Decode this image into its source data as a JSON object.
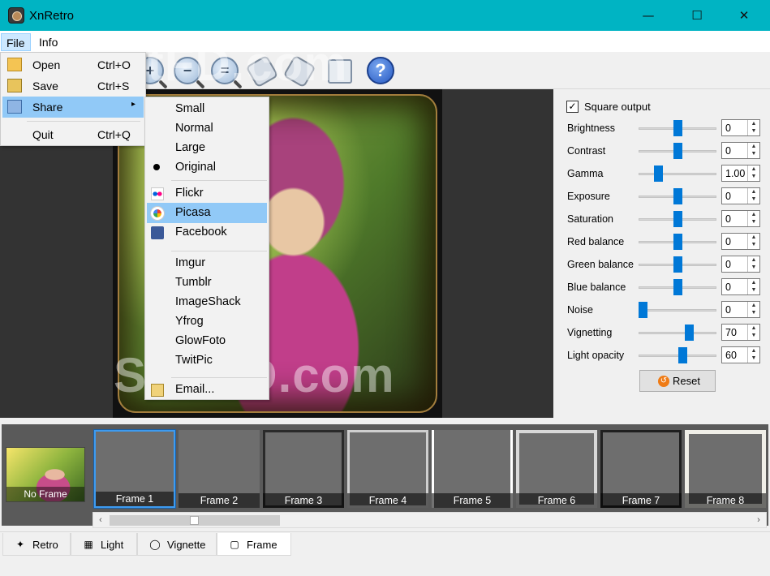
{
  "window": {
    "title": "XnRetro",
    "minimize": "—",
    "maximize": "☐",
    "close": "✕"
  },
  "menubar": {
    "file": "File",
    "info": "Info"
  },
  "file_menu": {
    "open": {
      "label": "Open",
      "shortcut": "Ctrl+O"
    },
    "save": {
      "label": "Save",
      "shortcut": "Ctrl+S"
    },
    "share": {
      "label": "Share",
      "arrow": "▸"
    },
    "quit": {
      "label": "Quit",
      "shortcut": "Ctrl+Q"
    }
  },
  "share_menu": {
    "sizes": [
      "Small",
      "Normal",
      "Large",
      "Original"
    ],
    "selected_size": "Original",
    "services_a": [
      "Flickr",
      "Picasa",
      "Facebook"
    ],
    "services_b": [
      "Imgur",
      "Tumblr",
      "ImageShack",
      "Yfrog",
      "GlowFoto",
      "TwitPic"
    ],
    "email": "Email...",
    "highlighted": "Picasa"
  },
  "toolbar": {
    "icons": [
      "zoom-in-icon",
      "zoom-out-icon",
      "zoom-fit-icon",
      "rotate-right-icon",
      "rotate-left-icon",
      "compare-icon",
      "help-icon"
    ],
    "help_symbol": "?"
  },
  "panel": {
    "square_output": {
      "label": "Square output",
      "checked": true,
      "mark": "✓"
    },
    "adjustments": [
      {
        "label": "Brightness",
        "value": "0",
        "level": 0.5
      },
      {
        "label": "Contrast",
        "value": "0",
        "level": 0.5
      },
      {
        "label": "Gamma",
        "value": "1.00",
        "level": 0.22
      },
      {
        "label": "Exposure",
        "value": "0",
        "level": 0.5
      },
      {
        "label": "Saturation",
        "value": "0",
        "level": 0.5
      },
      {
        "label": "Red balance",
        "value": "0",
        "level": 0.5
      },
      {
        "label": "Green balance",
        "value": "0",
        "level": 0.5
      },
      {
        "label": "Blue balance",
        "value": "0",
        "level": 0.5
      },
      {
        "label": "Noise",
        "value": "0",
        "level": 0.0
      },
      {
        "label": "Vignetting",
        "value": "70",
        "level": 0.67
      },
      {
        "label": "Light opacity",
        "value": "60",
        "level": 0.58
      }
    ],
    "reset": "Reset",
    "spin_up": "▲",
    "spin_down": "▼"
  },
  "frames": {
    "no_frame": "No Frame",
    "items": [
      "Frame 1",
      "Frame 2",
      "Frame 3",
      "Frame 4",
      "Frame 5",
      "Frame 6",
      "Frame 7",
      "Frame 8"
    ],
    "selected": "Frame 1",
    "scroll_left": "‹",
    "scroll_right": "›"
  },
  "tabs": [
    {
      "label": "Retro",
      "icon": "wand-icon",
      "glyph": "✦"
    },
    {
      "label": "Light",
      "icon": "film-icon",
      "glyph": "▦"
    },
    {
      "label": "Vignette",
      "icon": "vignette-icon",
      "glyph": "◯"
    },
    {
      "label": "Frame",
      "icon": "frame-icon",
      "glyph": "▢"
    }
  ],
  "active_tab": "Frame",
  "watermark": "SoftFD.com",
  "colors": {
    "titlebar": "#00b4c3",
    "highlight": "#91c9f7",
    "slider": "#0078d7",
    "selected_frame": "#3d9bf0"
  }
}
